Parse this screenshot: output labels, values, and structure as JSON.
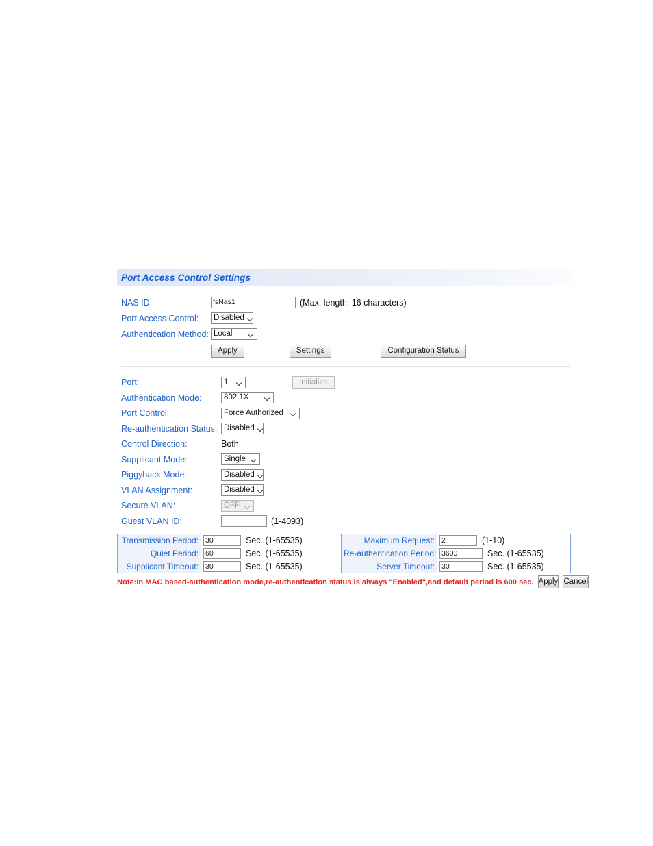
{
  "panel": {
    "title": "Port Access Control Settings"
  },
  "global": {
    "nas_id": {
      "label": "NAS ID:",
      "value": "fsNas1",
      "placeholder": "",
      "hint": "(Max. length: 16 characters)"
    },
    "port_access_control": {
      "label": "Port Access Control:",
      "value": "Disabled",
      "caret": "chevron-down-icon"
    },
    "authentication_method": {
      "label": "Authentication Method:",
      "value": "Local",
      "caret": "chevron-down-icon"
    },
    "buttons": {
      "apply": "Apply",
      "settings": "Settings",
      "configuration_status": "Configuration Status"
    }
  },
  "port": {
    "port": {
      "label": "Port:",
      "value": "1"
    },
    "initialize_button": "Initialize",
    "authentication_mode": {
      "label": "Authentication Mode:",
      "value": "802.1X"
    },
    "port_control": {
      "label": "Port Control:",
      "value": "Force Authorized"
    },
    "reauth_status": {
      "label": "Re-authentication Status:",
      "value": "Disabled"
    },
    "control_direction": {
      "label": "Control Direction:",
      "value": "Both"
    },
    "supplicant_mode": {
      "label": "Supplicant Mode:",
      "value": "Single"
    },
    "piggyback_mode": {
      "label": "Piggyback Mode:",
      "value": "Disabled"
    },
    "vlan_assignment": {
      "label": "VLAN Assignment:",
      "value": "Disabled"
    },
    "secure_vlan": {
      "label": "Secure VLAN:",
      "value": "OFF"
    },
    "guest_vlan_id": {
      "label": "Guest VLAN ID:",
      "value": "",
      "hint": "(1-4093)"
    }
  },
  "params": {
    "rows": [
      {
        "left": {
          "label": "Transmission Period:",
          "value": "30",
          "unit": "Sec. (1-65535)"
        },
        "right": {
          "label": "Maximum Request:",
          "value": "2",
          "unit": "(1-10)"
        }
      },
      {
        "left": {
          "label": "Quiet Period:",
          "value": "60",
          "unit": "Sec. (1-65535)"
        },
        "right": {
          "label": "Re-authentication Period:",
          "value": "3600",
          "unit": "Sec. (1-65535)"
        }
      },
      {
        "left": {
          "label": "Supplicant Timeout:",
          "value": "30",
          "unit": "Sec. (1-65535)"
        },
        "right": {
          "label": "Server Timeout:",
          "value": "30",
          "unit": "Sec. (1-65535)"
        }
      }
    ]
  },
  "footer": {
    "note": "Note:In MAC based-authentication mode,re-authentication status is always \"Enabled\",and default period is 600 sec.",
    "apply": "Apply",
    "cancel": "Cancel"
  },
  "colors": {
    "label_blue": "#2266cc",
    "title_blue": "#1a5fd0",
    "note_red": "#ee2222",
    "table_border": "#2a5fbf"
  }
}
